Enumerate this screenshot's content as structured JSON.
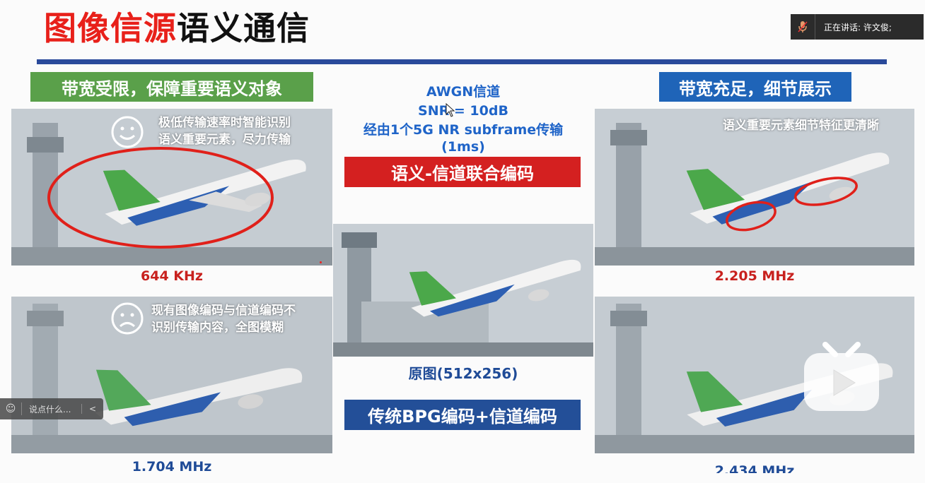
{
  "header": {
    "title_red": "图像信源",
    "title_black": "语义通信"
  },
  "speaker": {
    "label": "正在讲话: 许文俊;"
  },
  "left": {
    "banner": "带宽受限，保障重要语义对象",
    "top_note_line1": "极低传输速率时智能识别",
    "top_note_line2": "语义重要元素，尽力传输",
    "top_caption": "644 KHz",
    "bottom_note_line1": "现有图像编码与信道编码不",
    "bottom_note_line2": "识别传输内容，全图模糊",
    "bottom_caption": "1.704 MHz"
  },
  "center": {
    "line1": "AWGN信道",
    "line2": "SNR = 10dB",
    "line3": "经由1个5G NR subframe传输",
    "line4": "(1ms)",
    "red_banner": "语义-信道联合编码",
    "caption": "原图(512x256)",
    "blue_banner": "传统BPG编码+信道编码"
  },
  "right": {
    "banner": "带宽充足，细节展示",
    "top_note": "语义重要元素细节特征更清晰",
    "top_caption": "2.205 MHz",
    "bottom_caption": "2.434 MHz"
  },
  "chat": {
    "placeholder": "说点什么...",
    "collapse": "<"
  },
  "colors": {
    "title_red": "#e8201a",
    "banner_green": "#5aa04a",
    "banner_blue": "#1f64b8",
    "banner_red": "#d42020",
    "caption_red": "#c8211e",
    "caption_blue": "#1f4b97",
    "center_text_blue": "#1f64c8"
  }
}
